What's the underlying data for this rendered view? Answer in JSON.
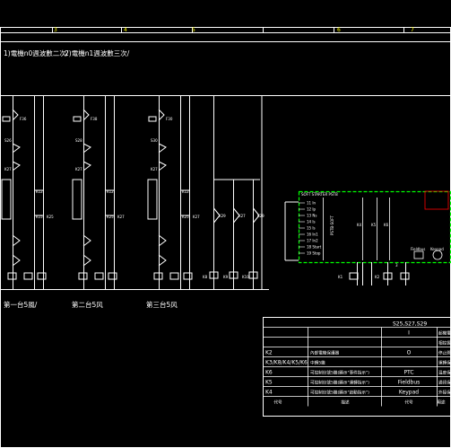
{
  "drawing": {
    "ruler_numbers": [
      "3",
      "4",
      "5",
      "6",
      "7"
    ],
    "notes": {
      "note1": "1)電機n0週波數二次/",
      "note2": "2)電機n1週波數三次/"
    },
    "fuses": [
      "F36",
      "F38",
      "F30"
    ],
    "switch_labels": [
      "S26",
      "S28",
      "S30"
    ],
    "relay_labels": [
      "K27",
      "K27",
      "K27"
    ],
    "unit_labels": [
      "第一台5風/",
      "第二台5风",
      "第三台5风"
    ],
    "k_labels": {
      "g1": [
        "K12",
        "K15",
        "K25"
      ],
      "g2": [
        "K12",
        "K25",
        "K27"
      ],
      "g3": [
        "K12",
        "K25",
        "K27"
      ],
      "right": [
        "K29",
        "K27",
        "K29",
        "K8",
        "K9",
        "K10"
      ],
      "bottom": [
        "K26",
        "K20",
        "K21",
        "K3",
        "K8",
        "K9",
        "K10"
      ]
    },
    "plc": {
      "title": "SOFT STARTER PSTB",
      "side": "PSTB-SOFT",
      "inputs": [
        "11 In",
        "12 Ip",
        "13 Ns",
        "14 Is",
        "15 Is",
        "16 In1",
        "17 In2",
        "18 Start",
        "19 Stop"
      ],
      "outputs": [
        "K4",
        "K5",
        "K6"
      ],
      "bottom_terminals": [
        "K1",
        "K2",
        "3"
      ],
      "legends": [
        "Keypad",
        "Fieldbus"
      ]
    }
  },
  "table": {
    "header_code": "S25,S27,S29",
    "rows": [
      {
        "code": "",
        "desc": "",
        "val": "I",
        "note": "起機電源"
      },
      {
        "code": "",
        "desc": "",
        "val": "",
        "note": "相控扱"
      },
      {
        "code": "K2",
        "desc": "內部電機保護器",
        "val": "O",
        "note": "停止開"
      },
      {
        "code": "K3/K8/K4/K5/K6",
        "desc": "中轉5繼",
        "val": "",
        "note": "運轉保"
      },
      {
        "code": "K6",
        "desc": "可控制信號5繼(顯示\"事件指示\")",
        "val": "PTC",
        "note": "温度保"
      },
      {
        "code": "K5",
        "desc": "可控制信號5繼(顯示\"運轉指示\")",
        "val": "Fieldbus",
        "note": "通訊保"
      },
      {
        "code": "K4",
        "desc": "可控制信號5繼(顯示\"啟動指示\")",
        "val": "Keypad",
        "note": "外接保"
      }
    ],
    "footer": {
      "code": "代号",
      "desc": "描述",
      "val": "代号",
      "note": "用途"
    }
  }
}
